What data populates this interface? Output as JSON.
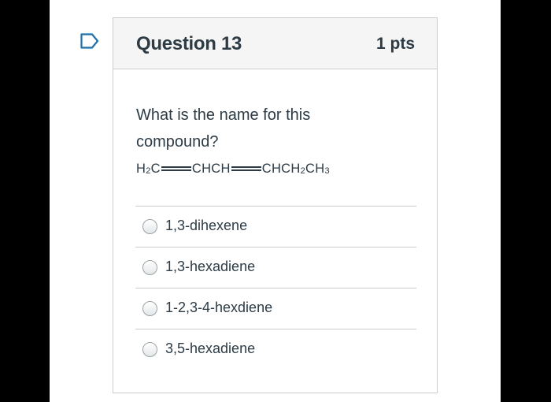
{
  "question": {
    "title": "Question 13",
    "points": "1 pts",
    "text": "What is the name for this compound?",
    "formula": {
      "p1": "H",
      "p1_sub": "2",
      "p2": "C",
      "p3": "CHCH",
      "p4": "CHCH",
      "p4_sub": "2",
      "p5": "CH",
      "p5_sub": "3"
    },
    "answers": [
      {
        "label": "1,3-dihexene",
        "selected": false
      },
      {
        "label": "1,3-hexadiene",
        "selected": false
      },
      {
        "label": "1-2,3-4-hexdiene",
        "selected": false
      },
      {
        "label": "3,5-hexadiene",
        "selected": false
      }
    ]
  },
  "icons": {
    "flag": "bookmark-flag-icon"
  },
  "colors": {
    "text": "#2d3b45",
    "border": "#c7cdd1",
    "header_bg": "#f5f5f5",
    "flag": "#1f6fa8"
  }
}
